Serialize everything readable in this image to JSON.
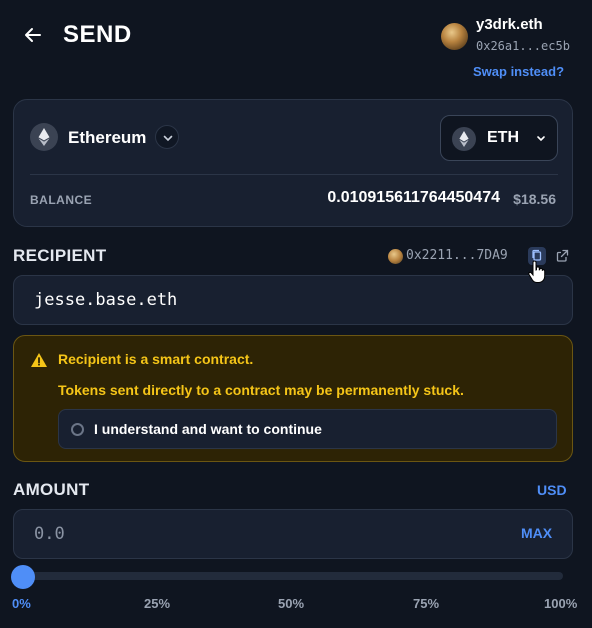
{
  "header": {
    "title": "SEND",
    "user_name": "y3drk.eth",
    "user_address": "0x26a1...ec5b",
    "swap_link": "Swap instead?"
  },
  "token_card": {
    "network_name": "Ethereum",
    "token_symbol": "ETH",
    "balance_label": "BALANCE",
    "balance_value": "0.010915611764450474",
    "balance_usd": "$18.56"
  },
  "recipient": {
    "label": "RECIPIENT",
    "resolved_address": "0x2211...7DA9",
    "input_value": "jesse.base.eth"
  },
  "warning": {
    "title": "Recipient is a smart contract.",
    "body": "Tokens sent directly to a contract may be permanently stuck.",
    "ack_label": "I understand and want to continue",
    "ack_checked": false
  },
  "amount": {
    "label": "AMOUNT",
    "currency_toggle": "USD",
    "placeholder": "0.0",
    "max_label": "MAX"
  },
  "slider": {
    "value_percent": 0,
    "ticks": [
      "0%",
      "25%",
      "50%",
      "75%",
      "100%"
    ]
  },
  "colors": {
    "background": "#0f1520",
    "card": "#182030",
    "accent": "#4f8ef7",
    "warning_text": "#f5c518",
    "warning_bg": "#2d2305"
  }
}
